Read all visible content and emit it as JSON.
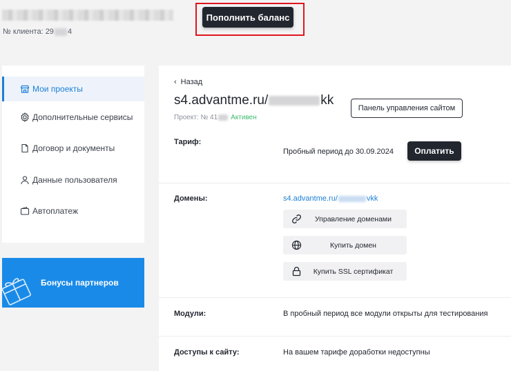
{
  "header": {
    "client_label": "№ клиента: 29",
    "client_suffix": "4",
    "topup_button": "Пополнить баланс"
  },
  "sidebar": {
    "items": [
      {
        "label": "Мои проекты",
        "icon": "store-icon"
      },
      {
        "label": "Дополнительные сервисы",
        "icon": "gear-icon"
      },
      {
        "label": "Договор и документы",
        "icon": "document-icon"
      },
      {
        "label": "Данные пользователя",
        "icon": "user-icon"
      },
      {
        "label": "Автоплатеж",
        "icon": "wallet-icon"
      }
    ],
    "bonus": {
      "label": "Бонусы партнеров",
      "icon": "gift-icon"
    }
  },
  "main": {
    "back_label": "Назад",
    "domain_prefix": "s4.advantme.ru/",
    "domain_suffix": "kk",
    "panel_button": "Панель управления сайтом",
    "project_label": "Проект: № 41",
    "project_status": "Активен",
    "tariff": {
      "label": "Тариф:",
      "value": "Пробный период до 30.09.2024",
      "pay_button": "Оплатить"
    },
    "domains": {
      "label": "Домены:",
      "link_prefix": "s4.advantme.ru/",
      "link_suffix": "vkk",
      "manage_button": "Управление доменами",
      "buy_button": "Купить домен",
      "ssl_button": "Купить SSL сертификат"
    },
    "modules": {
      "label": "Модули:",
      "value": "В пробный период все модули открыты для тестирования"
    },
    "access": {
      "label": "Доступы к сайту:",
      "value": "На вашем тарифе доработки недоступны"
    }
  },
  "colors": {
    "accent": "#1c7fd6",
    "dark": "#22262f",
    "highlight": "#e0151d",
    "success": "#3dbb6e"
  }
}
